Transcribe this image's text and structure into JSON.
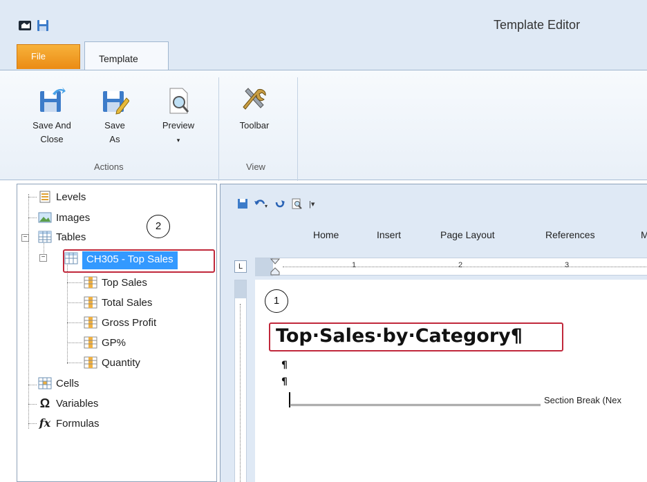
{
  "window": {
    "title": "Template Editor"
  },
  "tabs": {
    "file": "File",
    "template": "Template"
  },
  "ribbon": {
    "actions": {
      "group_label": "Actions",
      "save_and_close": [
        "Save And",
        "Close"
      ],
      "save_as": [
        "Save",
        "As"
      ],
      "preview": "Preview"
    },
    "view": {
      "group_label": "View",
      "toolbar": "Toolbar"
    }
  },
  "tree": {
    "levels": "Levels",
    "images": "Images",
    "tables": "Tables",
    "selected_table": "CH305 -  Top Sales",
    "children": [
      "Top Sales",
      "Total Sales",
      "Gross Profit",
      "GP%",
      "Quantity"
    ],
    "cells": "Cells",
    "variables": "Variables",
    "formulas": "Formulas"
  },
  "callouts": {
    "one": "1",
    "two": "2"
  },
  "editor": {
    "tabs": [
      "Home",
      "Insert",
      "Page Layout",
      "References",
      "M"
    ],
    "ruler_numbers": [
      "1",
      "2",
      "3"
    ],
    "tab_stop": "L",
    "heading": "Top·Sales·by·Category¶",
    "pilcrow": "¶",
    "section_break": "Section Break (Nex"
  },
  "colors": {
    "highlight_box": "#c0273a",
    "selection": "#3399ff",
    "file_tab": "#f0a02a"
  }
}
